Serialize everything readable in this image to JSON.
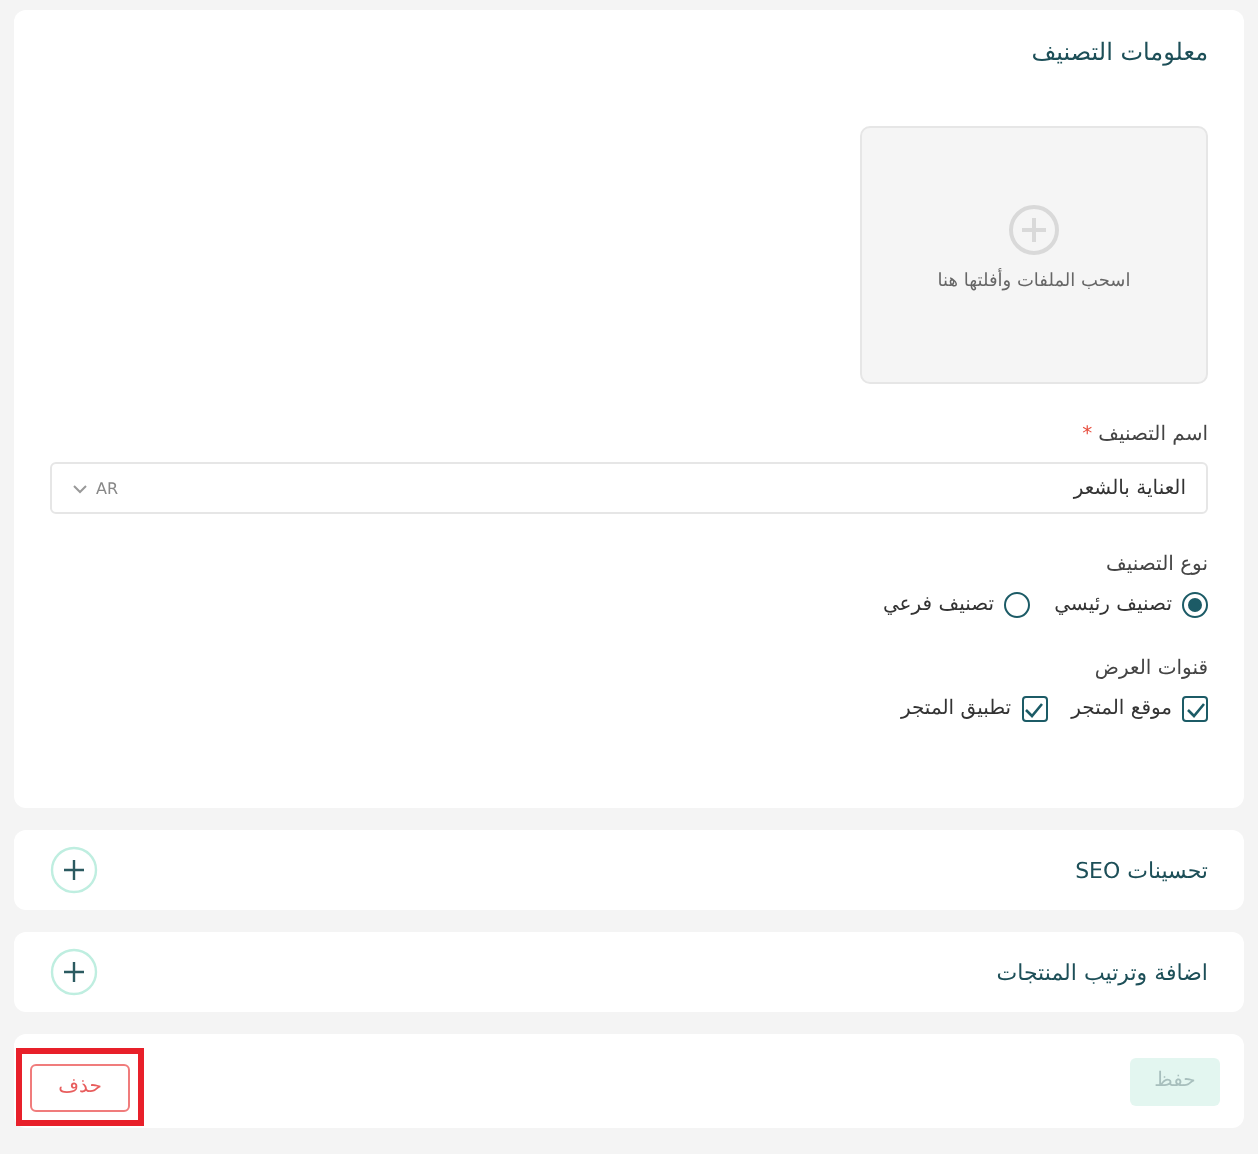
{
  "info_card": {
    "title": "معلومات التصنيف",
    "upload": {
      "hint": "اسحب الملفات وأفلتها هنا"
    },
    "name_field": {
      "label": "اسم التصنيف",
      "required_mark": "*",
      "value": "العناية بالشعر",
      "language": "AR"
    },
    "type_group": {
      "label": "نوع التصنيف",
      "options": [
        {
          "label": "تصنيف رئيسي",
          "selected": true
        },
        {
          "label": "تصنيف فرعي",
          "selected": false
        }
      ]
    },
    "channels_group": {
      "label": "قنوات العرض",
      "options": [
        {
          "label": "موقع المتجر",
          "checked": true
        },
        {
          "label": "تطبيق المتجر",
          "checked": true
        }
      ]
    }
  },
  "sections": [
    {
      "title": "تحسينات SEO",
      "expanded": false
    },
    {
      "title": "اضافة وترتيب المنتجات",
      "expanded": false
    }
  ],
  "footer": {
    "save_button": {
      "label": "حفظ",
      "disabled": true
    },
    "delete_button": {
      "label": "حذف",
      "highlighted": true
    }
  }
}
